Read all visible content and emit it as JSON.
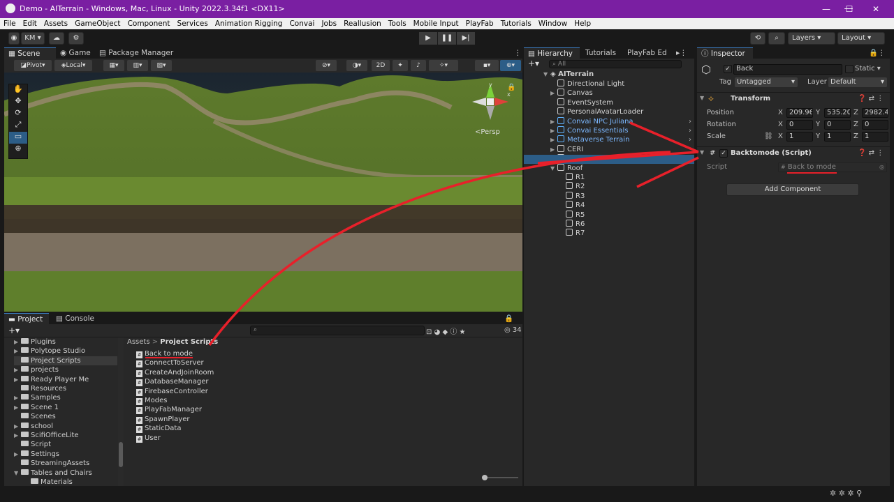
{
  "window": {
    "title": "Demo - AITerrain - Windows, Mac, Linux - Unity 2022.3.34f1 <DX11>",
    "minimize": "—",
    "maximize": "☐",
    "close": "✕"
  },
  "menu": [
    "File",
    "Edit",
    "Assets",
    "GameObject",
    "Component",
    "Services",
    "Animation Rigging",
    "Convai",
    "Jobs",
    "Reallusion",
    "Tools",
    "Mobile Input",
    "PlayFab",
    "Tutorials",
    "Window",
    "Help"
  ],
  "toolbar": {
    "account": "KM ▾",
    "cloud_icon": "cloud-icon",
    "play": "▶",
    "pause": "❚❚",
    "step": "▶|",
    "layers": "Layers",
    "layout": "Layout"
  },
  "scene": {
    "tabs": [
      "Scene",
      "Game",
      "Package Manager"
    ],
    "pivot": "Pivot",
    "local": "Local",
    "mode_2d": "2D",
    "persp": "<Persp"
  },
  "hierarchy": {
    "tabs": [
      "Hierarchy",
      "Tutorials",
      "PlayFab Ed"
    ],
    "search_placeholder": "All",
    "root": "AITerrain",
    "items": [
      {
        "label": "Directional Light",
        "arrow": "",
        "blue": false
      },
      {
        "label": "Canvas",
        "arrow": "▶",
        "blue": false
      },
      {
        "label": "EventSystem",
        "arrow": "",
        "blue": false
      },
      {
        "label": "PersonalAvatarLoader",
        "arrow": "",
        "blue": false
      },
      {
        "label": "Convai NPC Juliana",
        "arrow": "▶",
        "blue": true
      },
      {
        "label": "Convai Essentials",
        "arrow": "▶",
        "blue": true
      },
      {
        "label": "Metaverse Terrain",
        "arrow": "▶",
        "blue": true
      },
      {
        "label": "CERI",
        "arrow": "▶",
        "blue": false
      },
      {
        "label": "Back",
        "arrow": "",
        "blue": false
      },
      {
        "label": "Roof",
        "arrow": "▼",
        "blue": false
      }
    ],
    "roof_children": [
      "R1",
      "R2",
      "R3",
      "R4",
      "R5",
      "R6",
      "R7"
    ]
  },
  "inspector": {
    "tab": "Inspector",
    "object_name": "Back",
    "static_label": "Static",
    "tag_label": "Tag",
    "tag_value": "Untagged",
    "layer_label": "Layer",
    "layer_value": "Default",
    "transform": {
      "title": "Transform",
      "position_label": "Position",
      "rotation_label": "Rotation",
      "scale_label": "Scale",
      "position": {
        "x": "209.96",
        "y": "535.20",
        "z": "2982.4"
      },
      "rotation": {
        "x": "0",
        "y": "0",
        "z": "0"
      },
      "scale": {
        "x": "1",
        "y": "1",
        "z": "1"
      }
    },
    "script_component": {
      "title": "Backtomode (Script)",
      "script_label": "Script",
      "script_value": "Back to mode"
    },
    "add_component": "Add Component"
  },
  "project": {
    "tabs": [
      "Project",
      "Console"
    ],
    "breadcrumb_root": "Assets",
    "breadcrumb_current": "Project Scripts",
    "count": "34",
    "folders": [
      {
        "label": "Plugins",
        "arrow": "▶"
      },
      {
        "label": "Polytope Studio",
        "arrow": "▶"
      },
      {
        "label": "Project Scripts",
        "arrow": ""
      },
      {
        "label": "projects",
        "arrow": "▶"
      },
      {
        "label": "Ready Player Me",
        "arrow": "▶"
      },
      {
        "label": "Resources",
        "arrow": ""
      },
      {
        "label": "Samples",
        "arrow": "▶"
      },
      {
        "label": "Scene 1",
        "arrow": "▶"
      },
      {
        "label": "Scenes",
        "arrow": ""
      },
      {
        "label": "school",
        "arrow": "▶"
      },
      {
        "label": "ScifiOfficeLite",
        "arrow": "▶"
      },
      {
        "label": "Script",
        "arrow": ""
      },
      {
        "label": "Settings",
        "arrow": "▶"
      },
      {
        "label": "StreamingAssets",
        "arrow": ""
      },
      {
        "label": "Tables and Chairs",
        "arrow": "▼"
      },
      {
        "label": "Materials",
        "arrow": ""
      }
    ],
    "files": [
      "Back to mode",
      "ConnectToServer",
      "CreateAndJoinRoom",
      "DatabaseManager",
      "FirebaseController",
      "Modes",
      "PlayFabManager",
      "SpawnPlayer",
      "StaticData",
      "User"
    ]
  },
  "colors": {
    "titlebar": "#7a1fa2",
    "annotation": "#e8202a",
    "selection": "#2c5d87",
    "prefab_blue": "#7cb8ff"
  }
}
